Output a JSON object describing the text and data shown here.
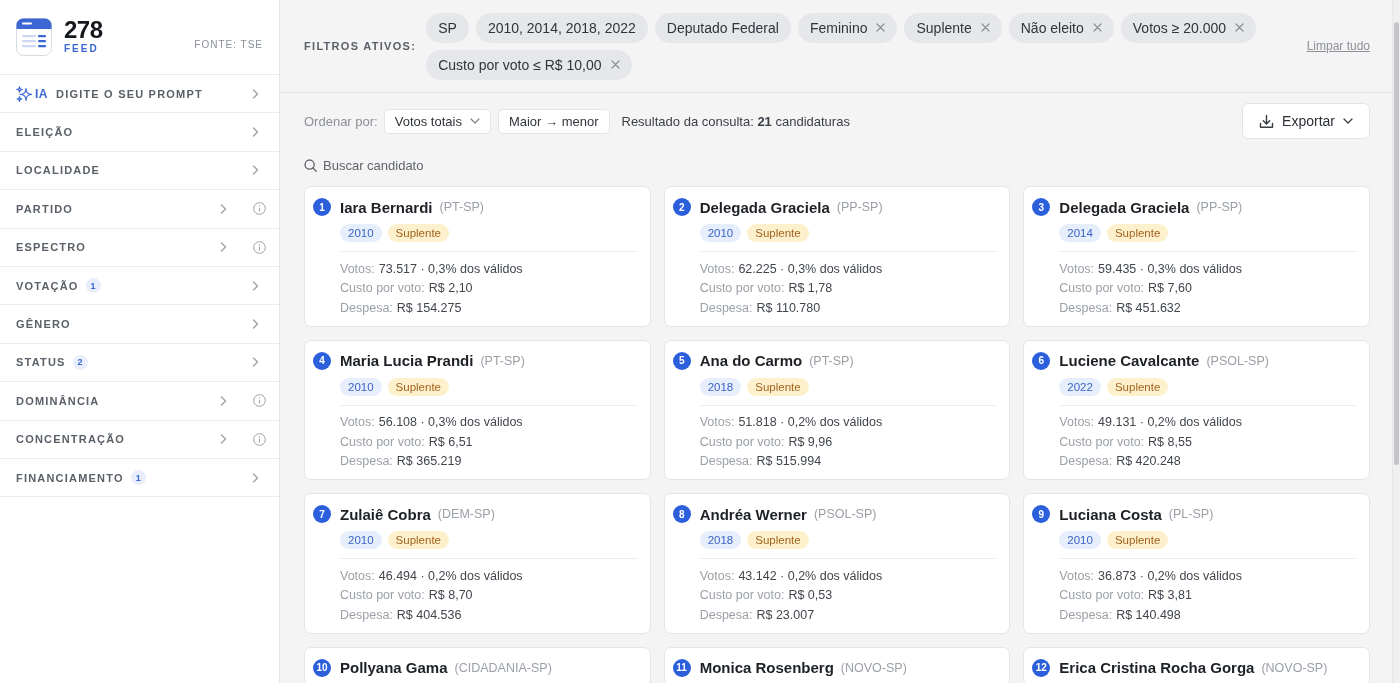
{
  "sidebar": {
    "logo": {
      "number": "278",
      "subtitle": "FEED"
    },
    "source": "FONTE: TSE",
    "items": [
      {
        "kind": "prompt",
        "tag": "IA",
        "label": "DIGITE O SEU PROMPT",
        "info": false
      },
      {
        "kind": "filter",
        "label": "ELEIÇÃO",
        "info": false
      },
      {
        "kind": "filter",
        "label": "LOCALIDADE",
        "info": false
      },
      {
        "kind": "filter",
        "label": "PARTIDO",
        "info": true
      },
      {
        "kind": "filter",
        "label": "ESPECTRO",
        "info": true
      },
      {
        "kind": "filter",
        "label": "VOTAÇÃO",
        "count": "1",
        "info": false
      },
      {
        "kind": "filter",
        "label": "GÊNERO",
        "info": false
      },
      {
        "kind": "filter",
        "label": "STATUS",
        "count": "2",
        "info": false
      },
      {
        "kind": "filter",
        "label": "DOMINÂNCIA",
        "info": true
      },
      {
        "kind": "filter",
        "label": "CONCENTRAÇÃO",
        "info": true
      },
      {
        "kind": "filter",
        "label": "FINANCIAMENTO",
        "count": "1",
        "info": false
      }
    ]
  },
  "filters": {
    "label": "FILTROS ATIVOS:",
    "chips": [
      {
        "label": "SP",
        "removable": false
      },
      {
        "label": "2010, 2014, 2018, 2022",
        "removable": false
      },
      {
        "label": "Deputado Federal",
        "removable": false
      },
      {
        "label": "Feminino",
        "removable": true
      },
      {
        "label": "Suplente",
        "removable": true
      },
      {
        "label": "Não eleito",
        "removable": true
      },
      {
        "label": "Votos ≥ 20.000",
        "removable": true
      },
      {
        "label": "Custo por voto ≤ R$ 10,00",
        "removable": true
      }
    ],
    "clear_all": "Limpar tudo"
  },
  "toolbar": {
    "sort_label": "Ordenar por:",
    "sort_field": "Votos totais",
    "sort_order": "Maior → menor",
    "result": "Resultado da consulta: **21** candidaturas",
    "export": "Exportar"
  },
  "search": {
    "placeholder": "Buscar candidato"
  },
  "cards": [
    {
      "rank": "1",
      "name": "Iara Bernardi",
      "party": "(PT-SP)",
      "year": "2010",
      "status": "Suplente",
      "stats": [
        {
          "label": "Votos:",
          "value": "73.517 · 0,3% dos válidos"
        },
        {
          "label": "Custo por voto:",
          "value": "R$ 2,10"
        },
        {
          "label": "Despesa:",
          "value": "R$ 154.275"
        }
      ]
    },
    {
      "rank": "2",
      "name": "Delegada Graciela",
      "party": "(PP-SP)",
      "year": "2010",
      "status": "Suplente",
      "stats": [
        {
          "label": "Votos:",
          "value": "62.225 · 0,3% dos válidos"
        },
        {
          "label": "Custo por voto:",
          "value": "R$ 1,78"
        },
        {
          "label": "Despesa:",
          "value": "R$ 110.780"
        }
      ]
    },
    {
      "rank": "3",
      "name": "Delegada Graciela",
      "party": "(PP-SP)",
      "year": "2014",
      "status": "Suplente",
      "stats": [
        {
          "label": "Votos:",
          "value": "59.435 · 0,3% dos válidos"
        },
        {
          "label": "Custo por voto:",
          "value": "R$ 7,60"
        },
        {
          "label": "Despesa:",
          "value": "R$ 451.632"
        }
      ]
    },
    {
      "rank": "4",
      "name": "Maria Lucia Prandi",
      "party": "(PT-SP)",
      "year": "2010",
      "status": "Suplente",
      "stats": [
        {
          "label": "Votos:",
          "value": "56.108 · 0,3% dos válidos"
        },
        {
          "label": "Custo por voto:",
          "value": "R$ 6,51"
        },
        {
          "label": "Despesa:",
          "value": "R$ 365.219"
        }
      ]
    },
    {
      "rank": "5",
      "name": "Ana do Carmo",
      "party": "(PT-SP)",
      "year": "2018",
      "status": "Suplente",
      "stats": [
        {
          "label": "Votos:",
          "value": "51.818 · 0,2% dos válidos"
        },
        {
          "label": "Custo por voto:",
          "value": "R$ 9,96"
        },
        {
          "label": "Despesa:",
          "value": "R$ 515.994"
        }
      ]
    },
    {
      "rank": "6",
      "name": "Luciene Cavalcante",
      "party": "(PSOL-SP)",
      "year": "2022",
      "status": "Suplente",
      "stats": [
        {
          "label": "Votos:",
          "value": "49.131 · 0,2% dos válidos"
        },
        {
          "label": "Custo por voto:",
          "value": "R$ 8,55"
        },
        {
          "label": "Despesa:",
          "value": "R$ 420.248"
        }
      ]
    },
    {
      "rank": "7",
      "name": "Zulaiê Cobra",
      "party": "(DEM-SP)",
      "year": "2010",
      "status": "Suplente",
      "stats": [
        {
          "label": "Votos:",
          "value": "46.494 · 0,2% dos válidos"
        },
        {
          "label": "Custo por voto:",
          "value": "R$ 8,70"
        },
        {
          "label": "Despesa:",
          "value": "R$ 404.536"
        }
      ]
    },
    {
      "rank": "8",
      "name": "Andréa Werner",
      "party": "(PSOL-SP)",
      "year": "2018",
      "status": "Suplente",
      "stats": [
        {
          "label": "Votos:",
          "value": "43.142 · 0,2% dos válidos"
        },
        {
          "label": "Custo por voto:",
          "value": "R$ 0,53"
        },
        {
          "label": "Despesa:",
          "value": "R$ 23.007"
        }
      ]
    },
    {
      "rank": "9",
      "name": "Luciana Costa",
      "party": "(PL-SP)",
      "year": "2010",
      "status": "Suplente",
      "stats": [
        {
          "label": "Votos:",
          "value": "36.873 · 0,2% dos válidos"
        },
        {
          "label": "Custo por voto:",
          "value": "R$ 3,81"
        },
        {
          "label": "Despesa:",
          "value": "R$ 140.498"
        }
      ]
    },
    {
      "rank": "10",
      "name": "Pollyana Gama",
      "party": "(CIDADANIA-SP)"
    },
    {
      "rank": "11",
      "name": "Monica Rosenberg",
      "party": "(NOVO-SP)"
    },
    {
      "rank": "12",
      "name": "Erica Cristina Rocha Gorga",
      "party": "(NOVO-SP)"
    }
  ]
}
